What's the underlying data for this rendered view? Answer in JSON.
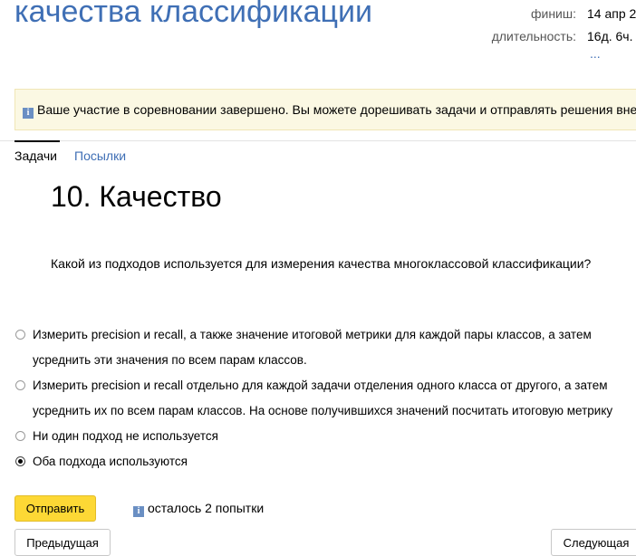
{
  "header": {
    "contest_title": "качества классификации",
    "finish_label": "финиш:",
    "finish_value": "14 апр 2",
    "duration_label": "длительность:",
    "duration_value": "16д. 6ч.",
    "more_link": "..."
  },
  "notice": {
    "icon": "info-icon",
    "text": "Ваше участие в соревновании завершено. Вы можете дорешивать задачи и отправлять решения вне"
  },
  "tabs": [
    {
      "label": "Задачи",
      "active": true
    },
    {
      "label": "Посылки",
      "active": false
    }
  ],
  "problem": {
    "title": "10. Качество",
    "question": "Какой из подходов используется для измерения качества многоклассовой классификации?",
    "options": [
      {
        "label": "Измерить precision и recall, а также значение итоговой метрики для каждой пары классов, а затем усреднить эти значения по всем парам классов.",
        "selected": false
      },
      {
        "label": "Измерить precision и recall отдельно для каждой задачи отделения одного класса от другого, а затем усреднить их по всем парам классов. На основе получившихся значений посчитать итоговую метрику",
        "selected": false
      },
      {
        "label": "Ни один подход не используется",
        "selected": false
      },
      {
        "label": "Оба подхода используются",
        "selected": true
      }
    ]
  },
  "actions": {
    "submit_label": "Отправить",
    "attempts_text": "осталось 2 попытки",
    "prev_label": "Предыдущая",
    "next_label": "Следующая"
  },
  "colors": {
    "accent": "#3f6fb5",
    "submit_button": "#fdd835",
    "notice_background": "#fbf8e3"
  }
}
